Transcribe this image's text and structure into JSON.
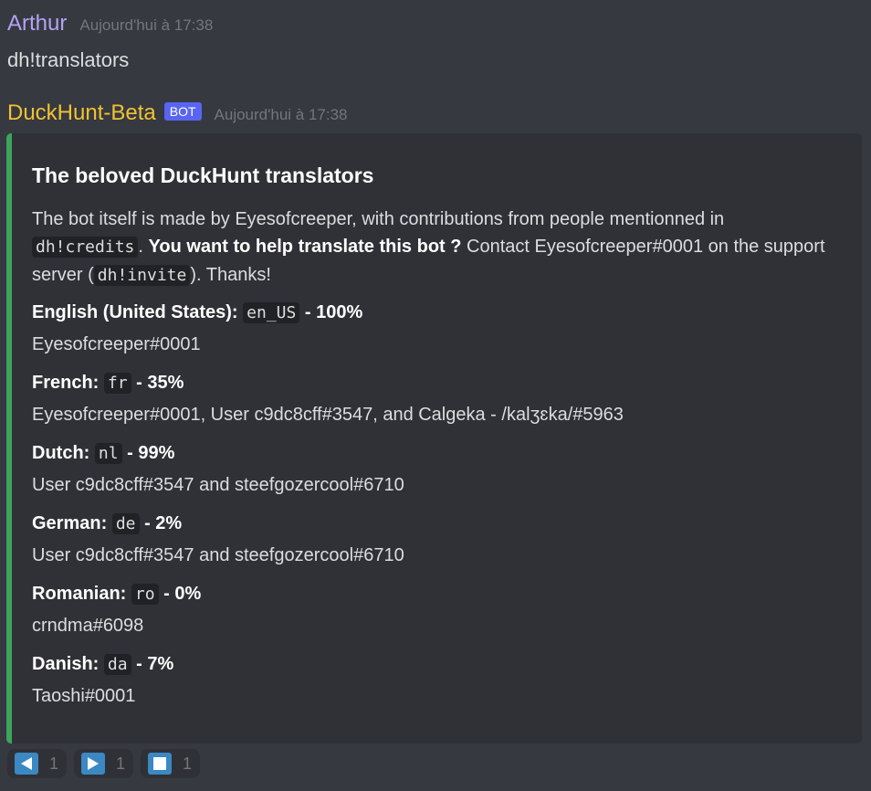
{
  "messages": [
    {
      "author": "Arthur",
      "author_color": "#b4a2f5",
      "timestamp": "Aujourd'hui à 17:38",
      "content": "dh!translators"
    },
    {
      "author": "DuckHunt-Beta",
      "author_color": "#f1c232",
      "bot_tag": "BOT",
      "timestamp": "Aujourd'hui à 17:38"
    }
  ],
  "embed": {
    "accent_color": "#3ba55c",
    "title": "The beloved DuckHunt translators",
    "description": {
      "p1": "The bot itself is made by Eyesofcreeper, with contributions from people mentionned in",
      "code1": "dh!credits",
      "p2": ".",
      "bold": "You want to help translate this bot ?",
      "p3": " Contact Eyesofcreeper#0001 on the support server (",
      "code2": "dh!invite",
      "p4": "). Thanks!"
    },
    "fields": [
      {
        "lang": "English (United States):",
        "code": "en_US",
        "pct": "- 100%",
        "value": "Eyesofcreeper#0001"
      },
      {
        "lang": "French:",
        "code": "fr",
        "pct": "- 35%",
        "value": "Eyesofcreeper#0001, User c9dc8cff#3547, and Calgeka - /kalʒɛka/#5963"
      },
      {
        "lang": "Dutch:",
        "code": "nl",
        "pct": "- 99%",
        "value": "User c9dc8cff#3547 and steefgozercool#6710"
      },
      {
        "lang": "German:",
        "code": "de",
        "pct": "- 2%",
        "value": "User c9dc8cff#3547 and steefgozercool#6710"
      },
      {
        "lang": "Romanian:",
        "code": "ro",
        "pct": "- 0%",
        "value": "crndma#6098"
      },
      {
        "lang": "Danish:",
        "code": "da",
        "pct": "- 7%",
        "value": "Taoshi#0001"
      }
    ]
  },
  "reactions": [
    {
      "icon": "arrow-backward-icon",
      "count": "1"
    },
    {
      "icon": "arrow-forward-icon",
      "count": "1"
    },
    {
      "icon": "stop-square-icon",
      "count": "1"
    }
  ]
}
